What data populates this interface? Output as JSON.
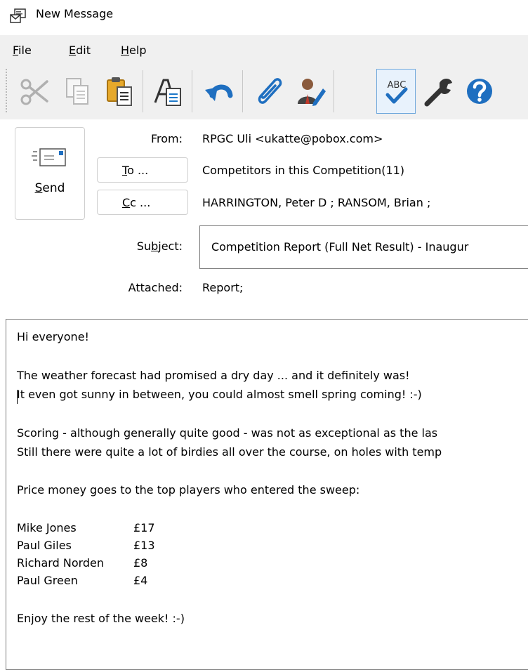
{
  "window": {
    "title": "New Message"
  },
  "menu": [
    {
      "accel": "F",
      "rest": "ile"
    },
    {
      "accel": "E",
      "rest": "dit"
    },
    {
      "accel": "H",
      "rest": "elp"
    }
  ],
  "toolbar": {
    "icons": [
      "cut-icon",
      "copy-icon",
      "paste-icon",
      "font-icon",
      "undo-icon",
      "attach-icon",
      "address-book-icon",
      "spell-check-icon",
      "settings-icon",
      "help-icon"
    ],
    "spell_label": "ABC"
  },
  "send": {
    "label_accel": "S",
    "label_rest": "end"
  },
  "from": {
    "label": "From:",
    "value": "RPGC Uli <ukatte@pobox.com>"
  },
  "to": {
    "button_accel": "T",
    "button_rest": "o ...",
    "value": "Competitors in this Competition(11)"
  },
  "cc": {
    "button_accel": "C",
    "button_rest": "c ...",
    "value": "HARRINGTON, Peter D ; RANSOM, Brian ;"
  },
  "subject": {
    "label_pre": "Su",
    "label_accel": "b",
    "label_post": "ject:",
    "value": "Competition Report (Full Net Result) - Inaugur"
  },
  "attached": {
    "label": "Attached:",
    "value": "Report;"
  },
  "body": {
    "greeting": "Hi everyone!",
    "para1": [
      "The weather forecast had promised a dry day ... and it definitely was!",
      "It even got sunny in between, you could almost smell spring coming! :-)"
    ],
    "para2": [
      "Scoring - although generally quite good - was not as exceptional as the las",
      "Still there were quite a lot of birdies all over the course, on holes with temp"
    ],
    "para3": "Price money goes to the top players who entered the sweep:",
    "sweep": [
      {
        "name": "Mike Jones",
        "amount": "£17"
      },
      {
        "name": "Paul Giles",
        "amount": "£13"
      },
      {
        "name": "Richard Norden",
        "amount": "£8"
      },
      {
        "name": "Paul Green",
        "amount": "£4"
      }
    ],
    "closing": "Enjoy the rest of the week! :-)"
  }
}
